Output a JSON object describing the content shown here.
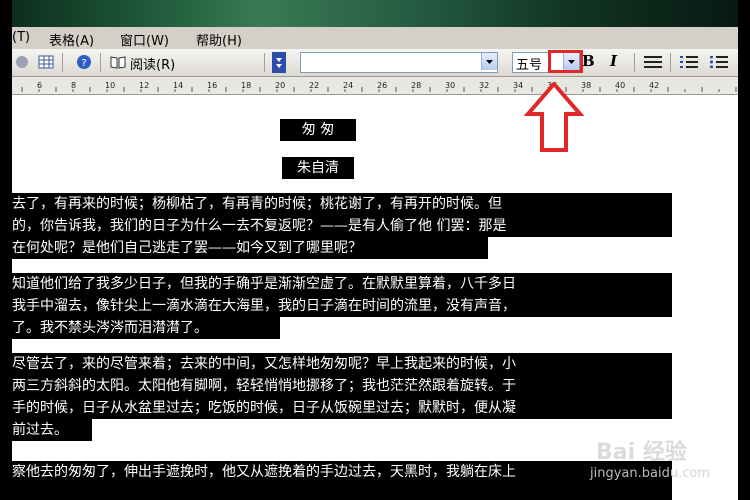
{
  "menu": {
    "items": [
      {
        "label": "(T)"
      },
      {
        "label": "表格(A)"
      },
      {
        "label": "窗口(W)"
      },
      {
        "label": "帮助(H)"
      }
    ]
  },
  "toolbar": {
    "read_label": "阅读(R)",
    "font_name": "",
    "font_size": "五号",
    "bold_label": "B",
    "italic_label": "I"
  },
  "ruler": {
    "ticks": [
      "6",
      "8",
      "10",
      "12",
      "14",
      "16",
      "18",
      "20",
      "22",
      "24",
      "26",
      "28",
      "30",
      "32",
      "34",
      "36",
      "38",
      "40",
      "42"
    ]
  },
  "document": {
    "title": "匆  匆",
    "author": "朱自清",
    "lines": [
      "去了，有再来的时候；杨柳枯了，有再青的时候；桃花谢了，有再开的时候。但",
      "的，你告诉我，我们的日子为什么一去不复返呢？——是有人偷了他 们罢：那是",
      "在何处呢？是他们自己逃走了罢——如今又到了哪里呢？",
      "知道他们给了我多少日子，但我的手确乎是渐渐空虚了。在默默里算着，八千多日",
      "我手中溜去，像针尖上一滴水滴在大海里，我的日子滴在时间的流里，没有声音，",
      "了。我不禁头涔涔而泪潸潸了。",
      "尽管去了，来的尽管来着；去来的中间，又怎样地匆匆呢？早上我起来的时候，小",
      "两三方斜斜的太阳。太阳他有脚啊，轻轻悄悄地挪移了；我也茫茫然跟着旋转。于",
      "手的时候，日子从水盆里过去；吃饭的时候，日子从饭碗里过去；默默时，便从凝",
      "前过去。",
      "察他去的匆匆了，伸出手遮挽时，他又从遮挽着的手边过去，天黑时，我躺在床上"
    ]
  },
  "watermark": {
    "logo": "Bai 经验",
    "url": "jingyan.baidu.com"
  }
}
